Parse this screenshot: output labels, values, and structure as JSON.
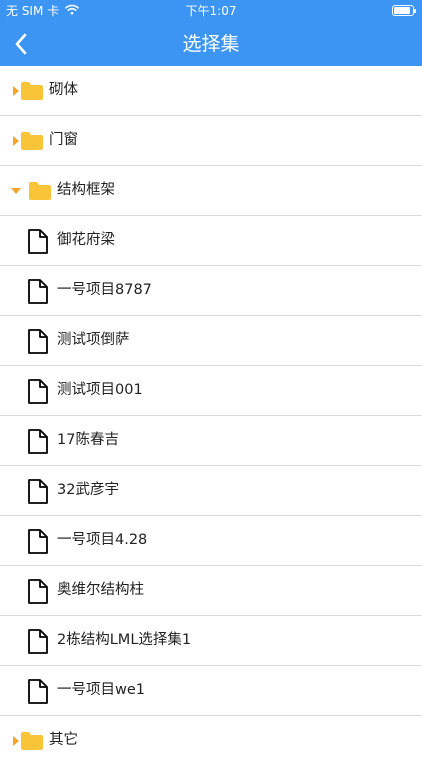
{
  "status_bar": {
    "carrier": "无 SIM 卡",
    "time": "下午1:07"
  },
  "nav": {
    "title": "选择集",
    "back_icon": "chevron-left-icon"
  },
  "tree": {
    "folders": [
      {
        "label": "砌体",
        "expanded": false
      },
      {
        "label": "门窗",
        "expanded": false
      },
      {
        "label": "结构框架",
        "expanded": true
      },
      {
        "label": "其它",
        "expanded": false
      }
    ],
    "files": [
      {
        "label": "御花府梁"
      },
      {
        "label": "一号项目8787"
      },
      {
        "label": "测试项倒萨"
      },
      {
        "label": "测试项目001"
      },
      {
        "label": "17陈春吉"
      },
      {
        "label": "32武彦宇"
      },
      {
        "label": "一号项目4.28"
      },
      {
        "label": "奥维尔结构柱"
      },
      {
        "label": "2栋结构LML选择集1"
      },
      {
        "label": "一号项目we1"
      }
    ]
  },
  "colors": {
    "header_bg": "#3d95f3",
    "folder": "#f9c437",
    "divider": "#d9d9d9"
  }
}
